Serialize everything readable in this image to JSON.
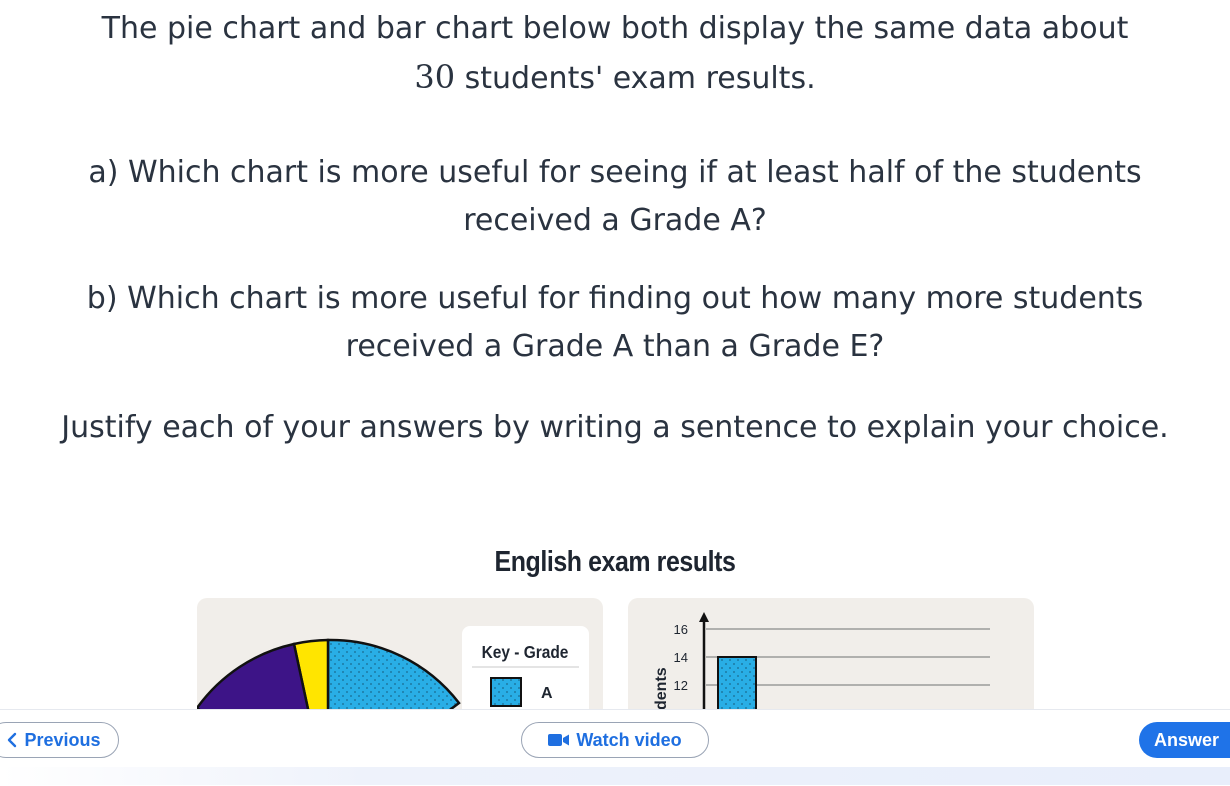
{
  "question": {
    "intro_before": "The pie chart and bar chart below both display the same data about",
    "intro_number": "30",
    "intro_after": " students' exam results.",
    "part_a": "a) Which chart is more useful for seeing if at least half of the students received a Grade A?",
    "part_b": "b) Which chart is more useful for finding out how many more students received a Grade A than a Grade E?",
    "justify": "Justify each of your answers by writing a sentence to explain your choice."
  },
  "figure": {
    "title": "English exam results",
    "key_title": "Key - Grade",
    "key_item_a": "A",
    "y_axis_label_partial": "dents"
  },
  "colors": {
    "grade_a": "#29aee6",
    "grade_b": "#ffe500",
    "grade_c": "#3d1487",
    "accent_blue": "#1f73e8"
  },
  "chart_data": {
    "type": "bar",
    "title": "English exam results",
    "categories": [
      "A"
    ],
    "values": [
      14
    ],
    "ylabel": "",
    "ylim": [
      0,
      16
    ],
    "y_ticks": [
      "16",
      "14",
      "12"
    ],
    "grid": true
  },
  "nav": {
    "previous_label": "Previous",
    "video_label": "Watch video",
    "answer_label": "Answer"
  }
}
